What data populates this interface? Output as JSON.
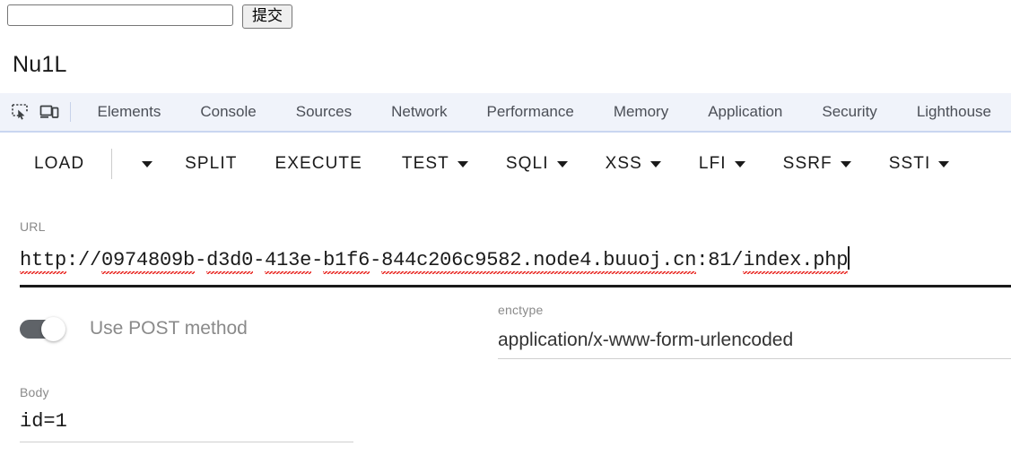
{
  "page": {
    "search_input_value": "",
    "search_input_placeholder": "",
    "submit_button_label": "提交",
    "heading": "Nu1L"
  },
  "devtools": {
    "icons": [
      {
        "name": "inspect-element-icon",
        "label": "inspect-element"
      },
      {
        "name": "device-toolbar-icon",
        "label": "device-toolbar"
      }
    ],
    "tabs": [
      {
        "label": "Elements"
      },
      {
        "label": "Console"
      },
      {
        "label": "Sources"
      },
      {
        "label": "Network"
      },
      {
        "label": "Performance"
      },
      {
        "label": "Memory"
      },
      {
        "label": "Application"
      },
      {
        "label": "Security"
      },
      {
        "label": "Lighthouse"
      }
    ],
    "tabbar_bg": "#f0f3fa"
  },
  "toolbar": {
    "items": [
      {
        "label": "LOAD",
        "caret": false
      },
      {
        "label": "",
        "caret": true
      },
      {
        "label": "SPLIT",
        "caret": false
      },
      {
        "label": "EXECUTE",
        "caret": false
      },
      {
        "label": "TEST",
        "caret": true
      },
      {
        "label": "SQLI",
        "caret": true
      },
      {
        "label": "XSS",
        "caret": true
      },
      {
        "label": "LFI",
        "caret": true
      },
      {
        "label": "SSRF",
        "caret": true
      },
      {
        "label": "SSTI",
        "caret": true
      }
    ]
  },
  "form": {
    "url": {
      "label": "URL",
      "value": "http://0974809b-d3d0-413e-b1f6-844c206c9582.node4.buuoj.cn:81/index.php",
      "segments": [
        {
          "text": "http",
          "misspelled": true
        },
        {
          "text": "://",
          "misspelled": false
        },
        {
          "text": "0974809b",
          "misspelled": true
        },
        {
          "text": "-",
          "misspelled": false
        },
        {
          "text": "d3d0",
          "misspelled": true
        },
        {
          "text": "-",
          "misspelled": false
        },
        {
          "text": "413e",
          "misspelled": true
        },
        {
          "text": "-",
          "misspelled": false
        },
        {
          "text": "b1f6",
          "misspelled": true
        },
        {
          "text": "-",
          "misspelled": false
        },
        {
          "text": "844c206c9582.node4.buuoj.cn",
          "misspelled": true
        },
        {
          "text": ":81/",
          "misspelled": false
        },
        {
          "text": "index.php",
          "misspelled": true
        }
      ]
    },
    "method_toggle": {
      "label": "Use POST method",
      "state": "on"
    },
    "enctype": {
      "label": "enctype",
      "value": "application/x-www-form-urlencoded"
    },
    "body": {
      "label": "Body",
      "value": "id=1"
    }
  }
}
